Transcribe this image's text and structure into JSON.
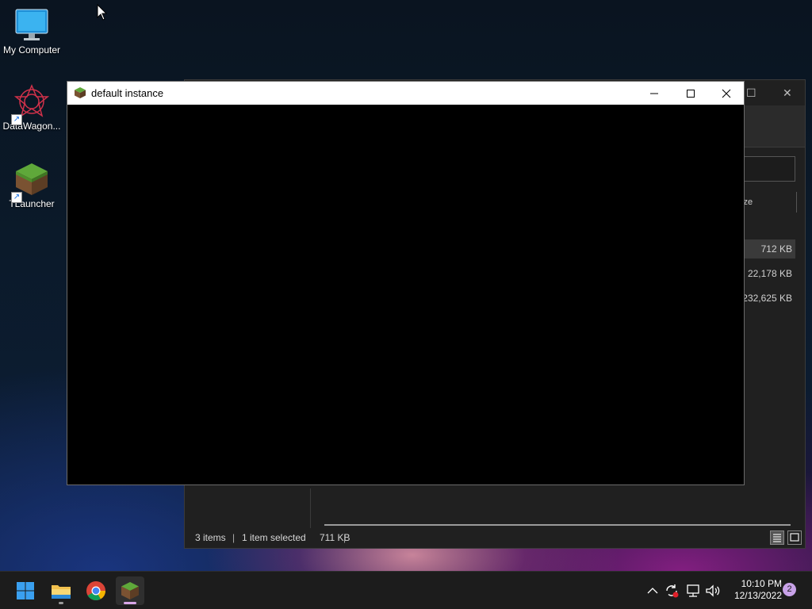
{
  "desktop": {
    "icons": [
      {
        "label": "My Computer",
        "icon": "monitor-icon"
      },
      {
        "label": "DataWagon...",
        "icon": "datawagon-icon"
      },
      {
        "label": "TLauncher",
        "icon": "grass-block-icon"
      }
    ]
  },
  "minecraft_window": {
    "title": "default instance",
    "icon": "grass-block-icon"
  },
  "explorer_window": {
    "column_header": "ize",
    "rows": [
      {
        "size": "712 KB",
        "selected": true
      },
      {
        "size": "22,178 KB",
        "selected": false
      },
      {
        "size": "232,625 KB",
        "selected": false
      }
    ],
    "status": {
      "items": "3 items",
      "selected": "1 item selected",
      "selected_size": "711 KB"
    }
  },
  "taskbar": {
    "apps": [
      "start-icon",
      "file-explorer-icon",
      "chrome-icon",
      "minecraft-icon"
    ],
    "clock": {
      "time": "10:10 PM",
      "date": "12/13/2022"
    },
    "notification_count": "2"
  },
  "colors": {
    "taskbar_bg": "#1c1c1c",
    "accent_blue": "#1e90ff",
    "notification_badge": "#c8a2e8"
  }
}
